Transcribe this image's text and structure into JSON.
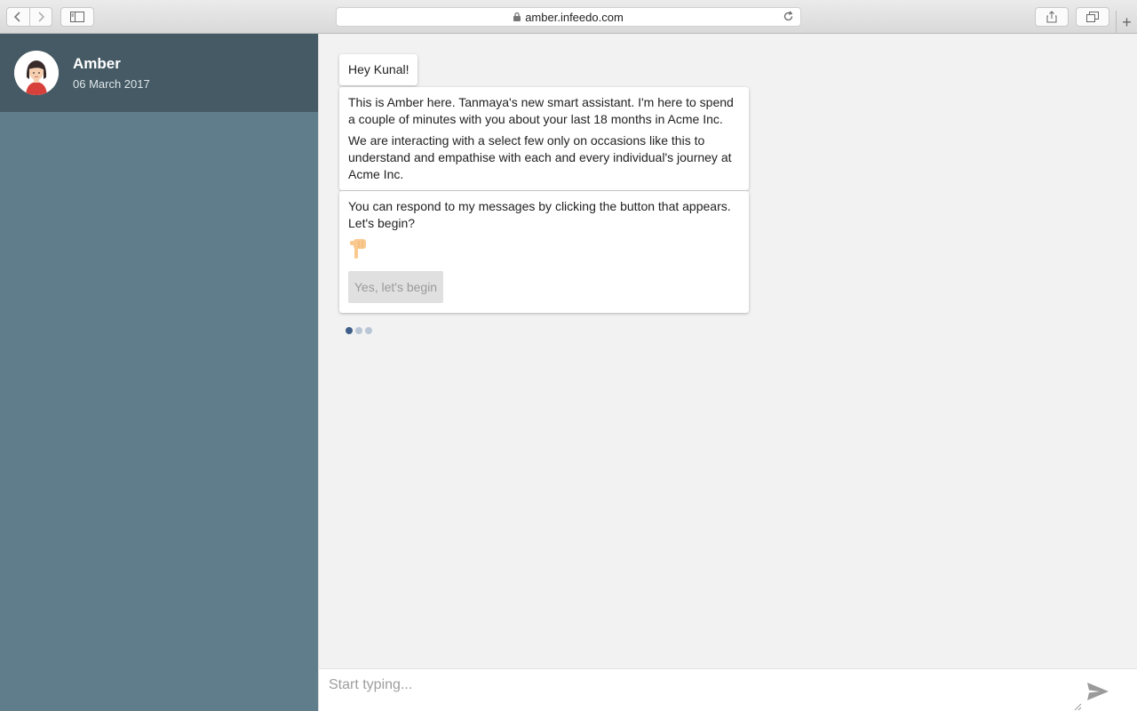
{
  "browser": {
    "url": "amber.infeedo.com",
    "icons": [
      "back-icon",
      "forward-icon",
      "sidebar-toggle-icon",
      "lock-icon",
      "reload-icon",
      "share-icon",
      "tabs-icon",
      "plus-icon"
    ]
  },
  "sidebar": {
    "name": "Amber",
    "date": "06 March 2017",
    "colors": {
      "header": "#455a64",
      "body": "#607d8b"
    }
  },
  "chat": {
    "messages": [
      {
        "paragraphs": [
          "Hey Kunal!"
        ]
      },
      {
        "paragraphs": [
          "This is Amber here. Tanmaya's new smart assistant. I'm here to spend a couple of minutes with you about your last 18 months in Acme Inc.",
          "We are interacting with a select few only on occasions like this to understand and empathise with each and every individual's journey at Acme Inc."
        ]
      },
      {
        "paragraphs": [
          "You can respond to my messages by clicking the button that appears. Let's begin?"
        ],
        "icon": "hand-pointing-down-icon",
        "button": "Yes, let's begin"
      }
    ],
    "typing_dot_colors": [
      "#3f5f8a",
      "#b9c6d6",
      "#b9c6d6"
    ]
  },
  "composer": {
    "placeholder": "Start typing...",
    "send_icon": "send-icon"
  }
}
